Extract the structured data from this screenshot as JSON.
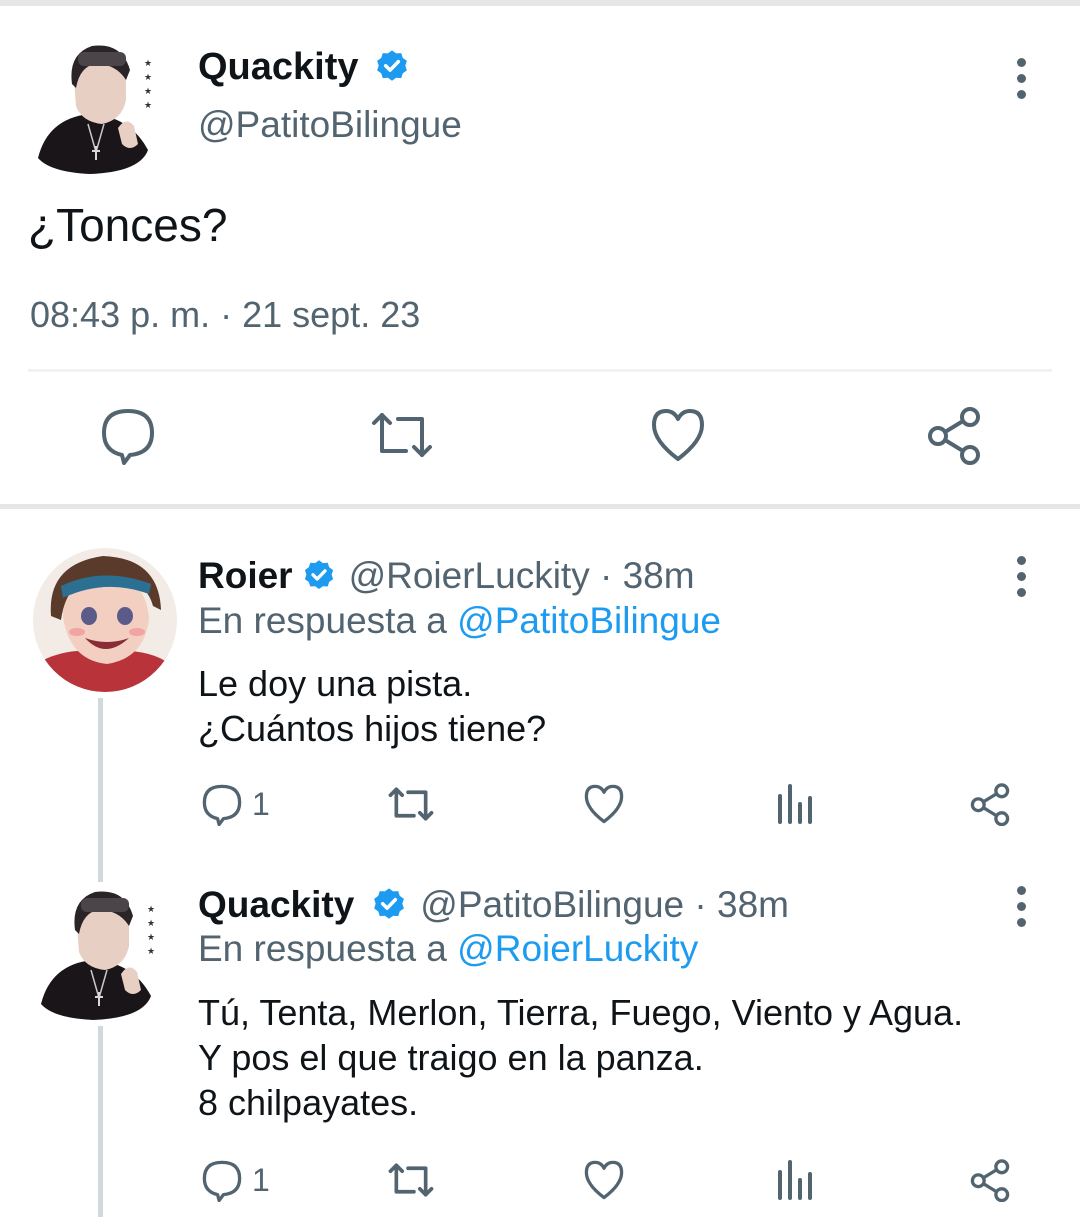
{
  "main_tweet": {
    "name": "Quackity",
    "handle": "@PatitoBilingue",
    "text": "¿Tonces?",
    "timestamp": "08:43 p. m. · 21 sept. 23"
  },
  "replies": [
    {
      "name": "Roier",
      "handle": "@RoierLuckity · 38m",
      "reply_prefix": "En respuesta a ",
      "reply_mention": "@PatitoBilingue",
      "lines": [
        "Le doy una pista.",
        "¿Cuántos hijos tiene?"
      ],
      "reply_count": "1"
    },
    {
      "name": "Quackity",
      "handle": "@PatitoBilingue · 38m",
      "reply_prefix": "En respuesta a ",
      "reply_mention": "@RoierLuckity",
      "lines": [
        "Tú, Tenta, Merlon, Tierra, Fuego, Viento y Agua.",
        "Y pos el que traigo en la panza.",
        "8 chilpayates."
      ],
      "reply_count": "1"
    }
  ],
  "colors": {
    "accent": "#1d9bf0",
    "muted_text": "#536471",
    "primary_text": "#0f1419",
    "icon": "#536471",
    "thread_line": "#cfd9de"
  },
  "icons": [
    "verified-badge-icon",
    "more-options-icon",
    "reply-icon",
    "retweet-icon",
    "like-icon",
    "views-icon",
    "share-icon"
  ]
}
